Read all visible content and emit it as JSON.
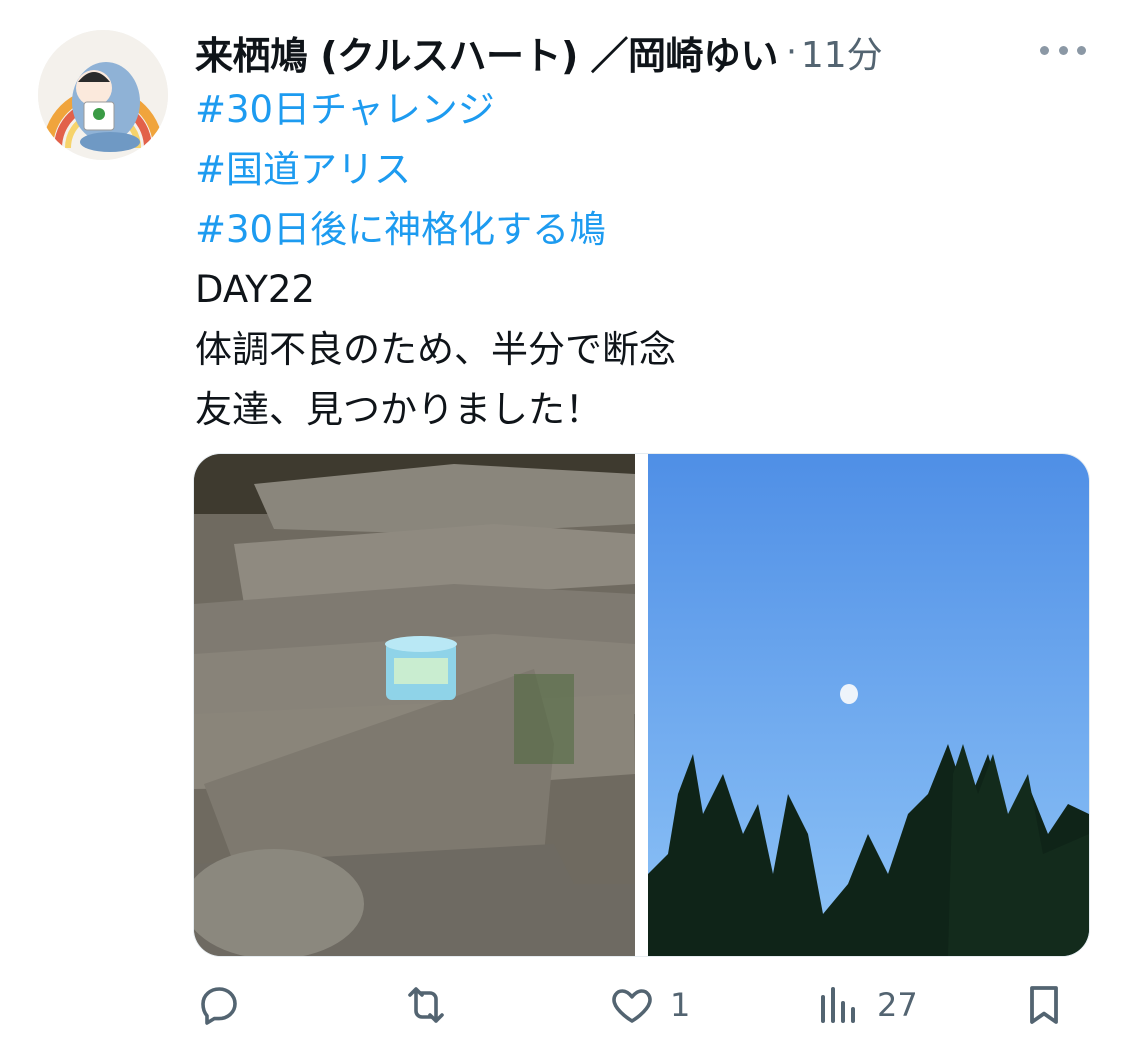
{
  "tweet": {
    "author_name": "来栖鳩 (クルスハート) ／岡崎ゆい",
    "separator": "·",
    "time": "11分",
    "hashtags": [
      "#30日チャレンジ",
      "#国道アリス",
      "#30日後に神格化する鳩"
    ],
    "body_lines": [
      "DAY22",
      "体調不良のため、半分で断念",
      "友達、見つかりました！"
    ]
  },
  "actions": {
    "reply_count": "",
    "retweet_count": "",
    "like_count": "1",
    "views_count": "27"
  },
  "colors": {
    "link": "#1d9bf0",
    "text": "#0f1419",
    "muted": "#536471"
  },
  "icons": [
    "avatar",
    "more-dots-icon",
    "reply-icon",
    "retweet-icon",
    "like-icon",
    "views-icon",
    "bookmark-icon"
  ]
}
